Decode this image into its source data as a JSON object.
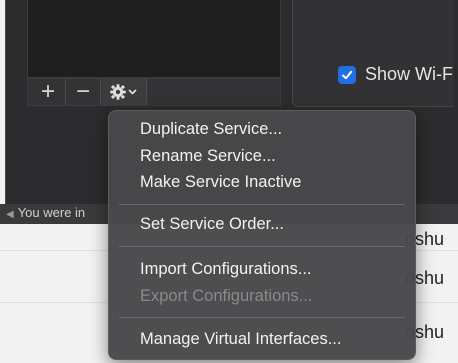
{
  "toolbar": {
    "add_label": "+",
    "remove_label": "−",
    "action_icon": "gear-icon",
    "chevron_label": "⌄"
  },
  "options": {
    "show_wifi_label": "Show Wi-F",
    "show_wifi_checked": true
  },
  "status": {
    "message": "You were in"
  },
  "lower_list": {
    "rows": [
      "oshu",
      "oshu",
      "oshu"
    ]
  },
  "context_menu": {
    "items": [
      {
        "label": "Duplicate Service...",
        "enabled": true
      },
      {
        "label": "Rename Service...",
        "enabled": true
      },
      {
        "label": "Make Service Inactive",
        "enabled": true
      },
      {
        "label": "Set Service Order...",
        "enabled": true
      },
      {
        "label": "Import Configurations...",
        "enabled": true
      },
      {
        "label": "Export Configurations...",
        "enabled": false
      },
      {
        "label": "Manage Virtual Interfaces...",
        "enabled": true
      }
    ]
  },
  "colors": {
    "accent": "#1f6fe5",
    "menu_bg": "#48484a",
    "window_bg": "#2c2c2e"
  }
}
